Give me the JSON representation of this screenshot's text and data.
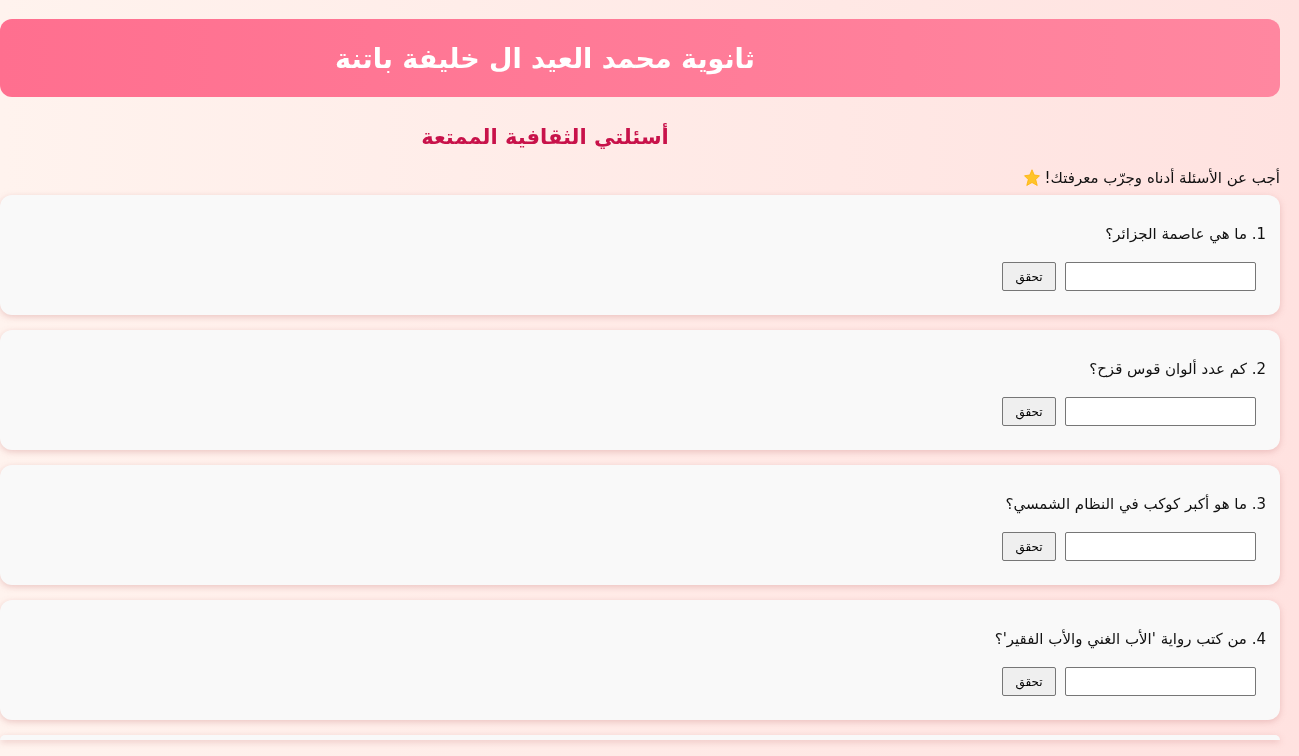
{
  "header": {
    "title": "ثانوية محمد العيد ال خليفة باتنة"
  },
  "heading": "أسئلتي الثقافية الممتعة",
  "intro": "أجب عن الأسئلة أدناه وجرّب معرفتك!",
  "questions": [
    {
      "text": "1. ما هي عاصمة الجزائر؟",
      "button": "تحقق"
    },
    {
      "text": "2. كم عدد ألوان قوس قزح؟",
      "button": "تحقق"
    },
    {
      "text": "3. ما هو أكبر كوكب في النظام الشمسي؟",
      "button": "تحقق"
    },
    {
      "text": "4. من كتب رواية 'الأب الغني والأب الفقير'؟",
      "button": "تحقق"
    }
  ],
  "next_card_peek": true
}
